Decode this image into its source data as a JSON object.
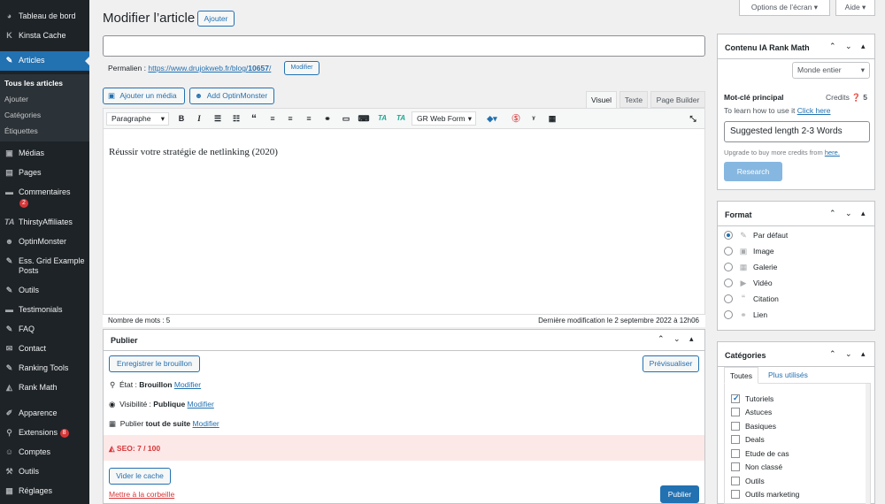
{
  "page": {
    "title": "Modifier l’article",
    "add_button": "Ajouter",
    "screen_options": "Options de l’écran",
    "help": "Aide"
  },
  "sidebar": {
    "items": [
      {
        "label": "Tableau de bord",
        "icon": "dashboard-icon"
      },
      {
        "label": "Kinsta Cache",
        "icon": "kinsta-icon"
      },
      {
        "label": "Articles",
        "icon": "pin-icon"
      },
      {
        "label": "Médias",
        "icon": "media-icon"
      },
      {
        "label": "Pages",
        "icon": "page-icon"
      },
      {
        "label": "Commentaires",
        "icon": "comment-icon",
        "badge": "2"
      },
      {
        "label": "ThirstyAffiliates",
        "icon": "thirsty-icon"
      },
      {
        "label": "OptinMonster",
        "icon": "optinmonster-icon"
      },
      {
        "label": "Ess. Grid Example Posts",
        "icon": "pin-icon"
      },
      {
        "label": "Outils",
        "icon": "pin-icon"
      },
      {
        "label": "Testimonials",
        "icon": "testimonial-icon"
      },
      {
        "label": "FAQ",
        "icon": "pin-icon"
      },
      {
        "label": "Contact",
        "icon": "mail-icon"
      },
      {
        "label": "Ranking Tools",
        "icon": "pin-icon"
      },
      {
        "label": "Rank Math",
        "icon": "rankmath-icon"
      },
      {
        "label": "Apparence",
        "icon": "brush-icon"
      },
      {
        "label": "Extensions",
        "icon": "plugin-icon",
        "badge": "8"
      },
      {
        "label": "Comptes",
        "icon": "user-icon"
      },
      {
        "label": "Outils",
        "icon": "wrench-icon"
      },
      {
        "label": "Réglages",
        "icon": "settings-icon"
      }
    ],
    "submenu": [
      "Tous les articles",
      "Ajouter",
      "Catégories",
      "Étiquettes"
    ]
  },
  "editor": {
    "title_value": "",
    "permalink_label": "Permalien :",
    "permalink_url": "https://www.drujokweb.fr/blog/",
    "permalink_slug": "10657",
    "permalink_button": "Modifier",
    "add_media": "Ajouter un média",
    "add_optinmonster": "Add OptinMonster",
    "tabs": [
      "Visuel",
      "Texte",
      "Page Builder"
    ],
    "format_select": "Paragraphe",
    "form_select": "GR Web Form",
    "content": "Réussir votre stratégie de netlinking (2020)",
    "word_count": "Nombre de mots : 5",
    "last_modified": "Dernière modification le 2 septembre 2022 à 12h06"
  },
  "publish": {
    "title": "Publier",
    "save_draft": "Enregistrer le brouillon",
    "preview": "Prévisualiser",
    "status_label": "État :",
    "status_value": "Brouillon",
    "visibility_label": "Visibilité :",
    "visibility_value": "Publique",
    "publish_label": "Publier",
    "publish_value": "tout de suite",
    "modify": "Modifier",
    "seo": "SEO: 7 / 100",
    "clear_cache": "Vider le cache",
    "trash": "Mettre à la corbeille",
    "publish_button": "Publier"
  },
  "rankmath": {
    "title": "Contenu IA Rank Math",
    "region": "Monde entier",
    "keyword_label": "Mot-clé principal",
    "credits_label": "Credits",
    "credits_value": "5",
    "learn": "To learn how to use it",
    "click_here": "Click here",
    "input_placeholder": "Suggested length 2-3 Words",
    "upgrade": "Upgrade to buy more credits from",
    "upgrade_link": "here.",
    "research": "Research"
  },
  "format": {
    "title": "Format",
    "options": [
      "Par défaut",
      "Image",
      "Galerie",
      "Vidéo",
      "Citation",
      "Lien"
    ],
    "selected": "Par défaut"
  },
  "categories": {
    "title": "Catégories",
    "tabs": [
      "Toutes",
      "Plus utilisés"
    ],
    "items": [
      "Tutoriels",
      "Astuces",
      "Basiques",
      "Deals",
      "Etude de cas",
      "Non classé",
      "Outils",
      "Outils marketing"
    ],
    "checked": "Tutoriels"
  },
  "colors": {
    "accent": "#2271b1",
    "sidebar": "#1d2327",
    "seo_bg": "#fde8e8",
    "seo_text": "#d63638"
  }
}
